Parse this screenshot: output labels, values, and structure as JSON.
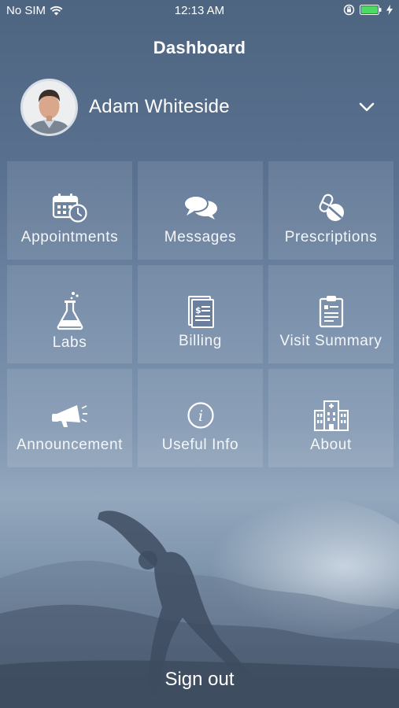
{
  "status_bar": {
    "carrier": "No SIM",
    "time": "12:13 AM"
  },
  "header": {
    "title": "Dashboard"
  },
  "profile": {
    "name": "Adam Whiteside"
  },
  "tiles": [
    {
      "label": "Appointments",
      "icon": "calendar-clock-icon"
    },
    {
      "label": "Messages",
      "icon": "chat-bubbles-icon"
    },
    {
      "label": "Prescriptions",
      "icon": "pills-icon"
    },
    {
      "label": "Labs",
      "icon": "flask-icon"
    },
    {
      "label": "Billing",
      "icon": "bill-icon"
    },
    {
      "label": "Visit Summary",
      "icon": "clipboard-icon"
    },
    {
      "label": "Announcement",
      "icon": "megaphone-icon"
    },
    {
      "label": "Useful Info",
      "icon": "info-icon"
    },
    {
      "label": "About",
      "icon": "hospital-icon"
    }
  ],
  "footer": {
    "signout_label": "Sign out"
  },
  "colors": {
    "battery": "#4cd964",
    "text": "#ffffff"
  }
}
